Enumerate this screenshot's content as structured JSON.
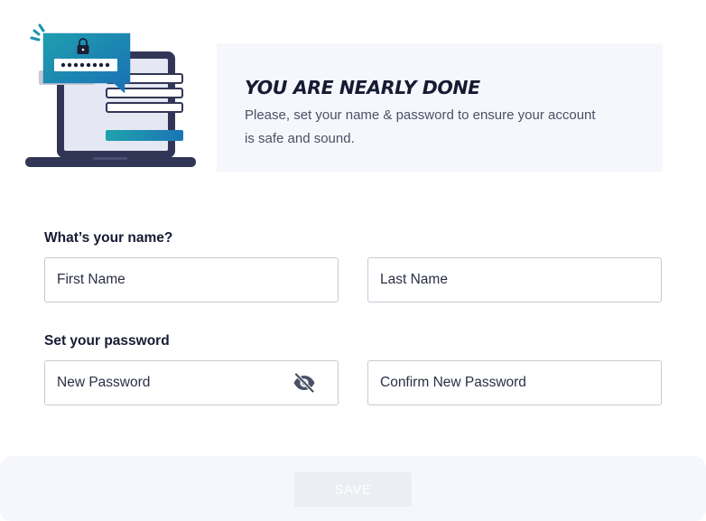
{
  "banner": {
    "title": "YOU ARE NEARLY DONE",
    "description": "Please, set your name & password to ensure your account is safe and sound.",
    "illustration_password_mask": "••••••••"
  },
  "name_section": {
    "label": "What’s your name?",
    "first_name_placeholder": "First Name",
    "last_name_placeholder": "Last Name"
  },
  "password_section": {
    "label": "Set your password",
    "new_password_placeholder": "New Password",
    "confirm_password_placeholder": "Confirm New Password"
  },
  "footer": {
    "save_label": "SAVE"
  },
  "colors": {
    "accent_teal": "#1a9aaa",
    "accent_blue": "#1a6fb5",
    "laptop_dark": "#323656",
    "banner_bg": "#f5f7fc",
    "save_disabled_bg": "#eceef3"
  },
  "icons": {
    "password_visibility": "eye-slash-icon",
    "lock": "lock-icon"
  }
}
